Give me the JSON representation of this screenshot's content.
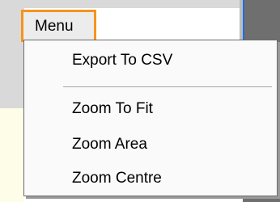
{
  "menu": {
    "tab_label": "Menu",
    "items": [
      {
        "label": "Export To CSV"
      },
      {
        "label": "Zoom To Fit"
      },
      {
        "label": "Zoom Area"
      },
      {
        "label": "Zoom Centre"
      }
    ]
  },
  "colors": {
    "tab_accent": "#f7941d",
    "menu_background": "#fafafa",
    "menu_border": "#6b6b6b"
  }
}
